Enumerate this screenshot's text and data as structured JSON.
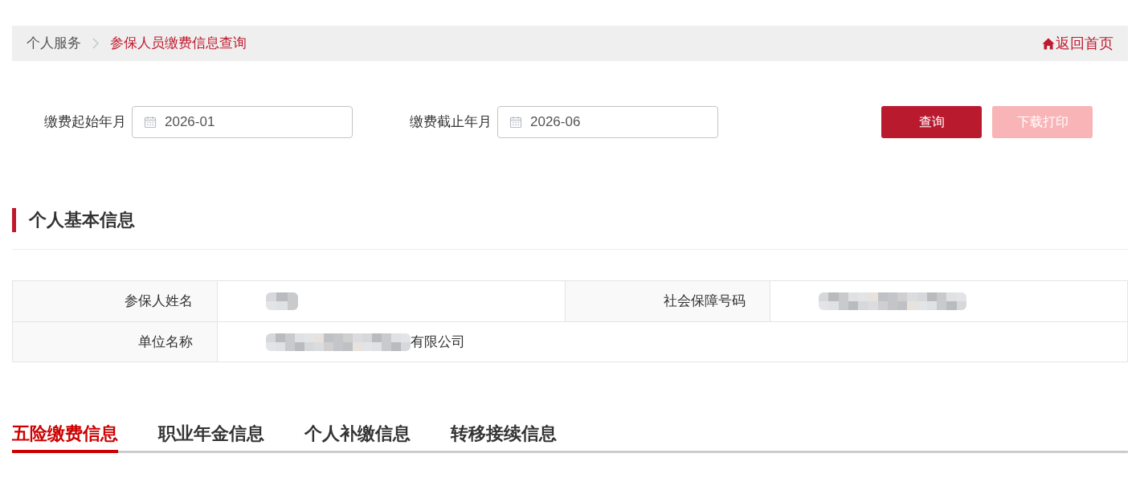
{
  "breadcrumb": {
    "items": [
      {
        "label": "个人服务",
        "selected": false
      },
      {
        "label": "参保人员缴费信息查询",
        "selected": true
      }
    ],
    "home_link": "返回首页"
  },
  "filters": [
    {
      "label": "缴费起始年月",
      "value": "2026-01"
    },
    {
      "label": "缴费截止年月",
      "value": "2026-06"
    }
  ],
  "buttons": [
    {
      "label": "查询",
      "disabled": false
    },
    {
      "label": "下载打印",
      "disabled": true
    }
  ],
  "section": {
    "title": "个人基本信息"
  },
  "info_table": {
    "rows": [
      {
        "fields": [
          {
            "label": "参保人姓名",
            "redacted": true
          },
          {
            "label": "社会保障号码",
            "redacted": true
          }
        ]
      },
      {
        "fields": [
          {
            "label": "单位名称",
            "redacted": true,
            "value": "有限公司"
          }
        ]
      }
    ]
  },
  "tabs": [
    {
      "label": "五险缴费信息",
      "selected": true
    },
    {
      "label": "职业年金信息",
      "selected": false
    },
    {
      "label": "个人补缴信息",
      "selected": false
    },
    {
      "label": "转移接续信息",
      "selected": false
    }
  ]
}
